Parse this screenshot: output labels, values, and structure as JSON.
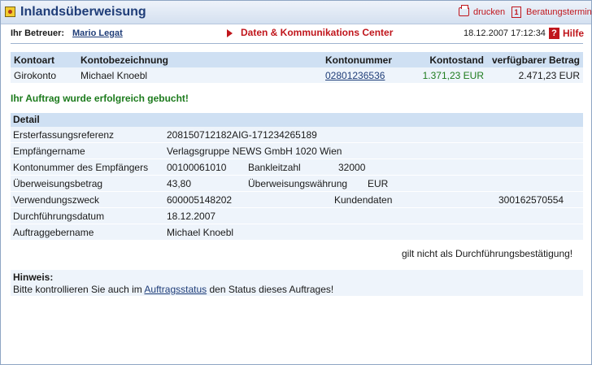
{
  "header": {
    "title": "Inlandsüberweisung",
    "print_label": "drucken",
    "appointment_label": "Beratungstermin"
  },
  "subheader": {
    "advisor_label": "Ihr Betreuer:",
    "advisor_name": "Mario Legat",
    "center_label": "Daten & Kommunikations Center",
    "datetime": "18.12.2007 17:12:34",
    "help_label": "Hilfe"
  },
  "account_table": {
    "headers": [
      "Kontoart",
      "Kontobezeichnung",
      "Kontonummer",
      "Kontostand",
      "verfügbarer Betrag"
    ],
    "row": {
      "type": "Girokonto",
      "name": "Michael Knoebl",
      "number": "02801236536",
      "balance": "1.371,23 EUR",
      "available": "2.471,23 EUR"
    }
  },
  "success_message": "Ihr Auftrag wurde erfolgreich gebucht!",
  "detail": {
    "heading": "Detail",
    "reference_label": "Ersterfassungsreferenz",
    "reference_value": "208150712182AIG-171234265189",
    "recipient_label": "Empfängername",
    "recipient_value": "Verlagsgruppe NEWS GmbH 1020 Wien",
    "recipient_account_label": "Kontonummer des Empfängers",
    "recipient_account_value": "00100061010",
    "bank_code_label": "Bankleitzahl",
    "bank_code_value": "32000",
    "amount_label": "Überweisungsbetrag",
    "amount_value": "43,80",
    "currency_label": "Überweisungswährung",
    "currency_value": "EUR",
    "purpose_label": "Verwendungszweck",
    "purpose_value": "600005148202",
    "customer_data_label": "Kundendaten",
    "customer_data_value": "300162570554",
    "execution_date_label": "Durchführungsdatum",
    "execution_date_value": "18.12.2007",
    "orderer_label": "Auftraggebername",
    "orderer_value": "Michael Knoebl"
  },
  "confirmation_note": "gilt nicht als Durchführungsbestätigung!",
  "hint": {
    "title": "Hinweis:",
    "text_before": "Bitte kontrollieren Sie auch im ",
    "link": "Auftragsstatus",
    "text_after": " den Status dieses Auftrages!"
  }
}
